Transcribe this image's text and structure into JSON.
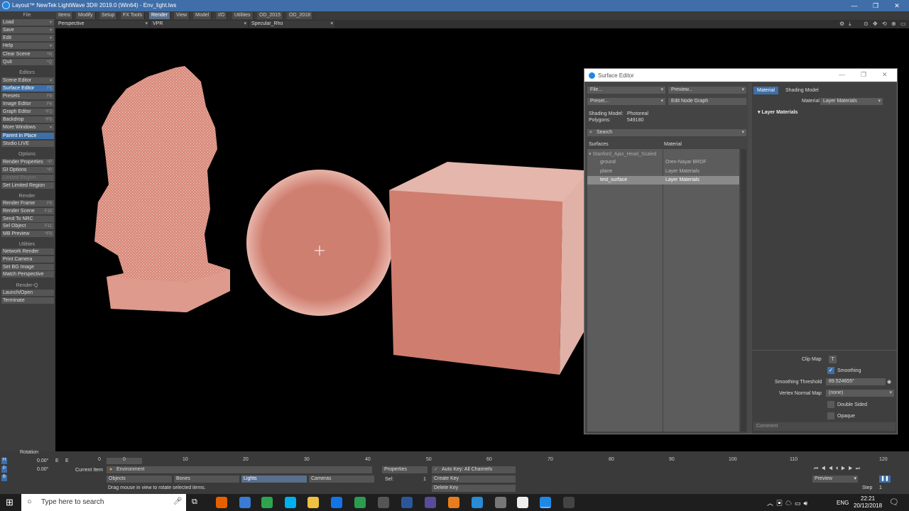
{
  "window": {
    "title": "Layout™ NewTek LightWave 3D® 2019.0 (Win64) - Env_light.lws",
    "min": "—",
    "max": "❐",
    "close": "✕"
  },
  "menubar": {
    "tabs": [
      "Items",
      "Modify",
      "Setup",
      "FX Tools",
      "Render",
      "View",
      "Model",
      "I/O",
      "Utilities",
      "OD_2015",
      "OD_2018"
    ],
    "active": "Render"
  },
  "leftpanel": {
    "file_head": "File",
    "file_items": [
      {
        "label": "Load"
      },
      {
        "label": "Save"
      },
      {
        "label": "Edit"
      },
      {
        "label": "Help"
      }
    ],
    "scene_items": [
      {
        "label": "Clear Scene",
        "key": "^N"
      },
      {
        "label": "Quit",
        "key": "^Q"
      }
    ],
    "editors_head": "Editors",
    "editors_items": [
      {
        "label": "Scene Editor",
        "key": ""
      },
      {
        "label": "Surface Editor",
        "key": "F5"
      },
      {
        "label": "Presets",
        "key": "F8"
      },
      {
        "label": "Image Editor",
        "key": "F6"
      },
      {
        "label": "Graph Editor",
        "key": "^F2"
      },
      {
        "label": "Backdrop",
        "key": "^F5"
      },
      {
        "label": "More Windows",
        "key": ""
      }
    ],
    "parent_items": [
      {
        "label": "Parent in Place",
        "key": ""
      },
      {
        "label": "Studio LIVE",
        "key": ""
      }
    ],
    "options_head": "Options",
    "options_items": [
      {
        "label": "Render Properties",
        "key": "^P"
      },
      {
        "label": "GI Options",
        "key": "^P"
      },
      {
        "label": "Limited Region",
        "key": ""
      },
      {
        "label": "Set Limited Region",
        "key": ""
      }
    ],
    "render_head": "Render",
    "render_items": [
      {
        "label": "Render Frame",
        "key": "F9"
      },
      {
        "label": "Render Scene",
        "key": "F10"
      },
      {
        "label": "Send To NRC",
        "key": ""
      },
      {
        "label": "Sel Object",
        "key": "F11"
      },
      {
        "label": "MB Preview",
        "key": "^F9"
      }
    ],
    "utilities_head": "Utilities",
    "utilities_items": [
      {
        "label": "Network Render"
      },
      {
        "label": "Print Camera"
      },
      {
        "label": "Set BG Image"
      },
      {
        "label": "Match Perspective"
      }
    ],
    "renderq_head": "Render-Q",
    "renderq_items": [
      {
        "label": "Launch/Open"
      },
      {
        "label": "Terminate"
      }
    ]
  },
  "viewport": {
    "view": "Perspective",
    "mode": "VPR",
    "shader": "Specular_Rho"
  },
  "surface_editor": {
    "title": "Surface Editor",
    "file_dd": "File...",
    "preview_dd": "Preview...",
    "preset_dd": "Preset...",
    "edit_node_graph": "Edit Node Graph",
    "shading_model_label": "Shading Model:",
    "shading_model_value": "Photoreal",
    "polygons_label": "Polygons:",
    "polygons_value": "549180",
    "search_placeholder": "Search",
    "col_surfaces": "Surfaces",
    "col_material": "Material",
    "group": "Stanford_Ajax_Head_Scaled",
    "rows": [
      {
        "surface": "ground",
        "material": "Oren-Nayar BRDF"
      },
      {
        "surface": "plane",
        "material": "Layer Materials"
      },
      {
        "surface": "test_surface",
        "material": "Layer Materials"
      }
    ],
    "tab_material": "Material",
    "tab_shading": "Shading Model",
    "material_label": "Material",
    "material_value": "Layer Materials",
    "layer_materials": "Layer Materials",
    "clip_map": "Clip Map",
    "clip_map_btn": "T",
    "smoothing": "Smoothing",
    "smoothing_threshold_label": "Smoothing Threshold",
    "smoothing_threshold_value": "89.524655°",
    "vertex_normal_label": "Vertex Normal Map",
    "vertex_normal_value": "(none)",
    "double_sided": "Double Sided",
    "opaque": "Opaque",
    "comment": "Comment"
  },
  "timeline": {
    "rotation": "Rotation",
    "h": "H",
    "p": "P",
    "b": "B",
    "h_val": "0.00°",
    "p_val": "0.00°",
    "e": "E",
    "ticks": [
      "0",
      "0",
      "10",
      "20",
      "30",
      "40",
      "50",
      "60",
      "70",
      "80",
      "90",
      "100",
      "110",
      "120"
    ],
    "current_item_label": "Current Item",
    "current_item": "Environment",
    "objects": "Objects",
    "bones": "Bones",
    "lights": "Lights",
    "cameras": "Cameras",
    "properties": "Properties",
    "sel_label": "Sel:",
    "sel_value": "1",
    "auto_key": "Auto Key: All Channels",
    "create_key": "Create Key",
    "delete_key": "Delete Key",
    "status": "Drag mouse in view to rotate selected items.",
    "preview": "Preview",
    "step": "Step",
    "step_value": "1"
  },
  "taskbar": {
    "search": "Type here to search",
    "lang": "ENG",
    "time": "22:21",
    "date": "20/12/2018"
  }
}
